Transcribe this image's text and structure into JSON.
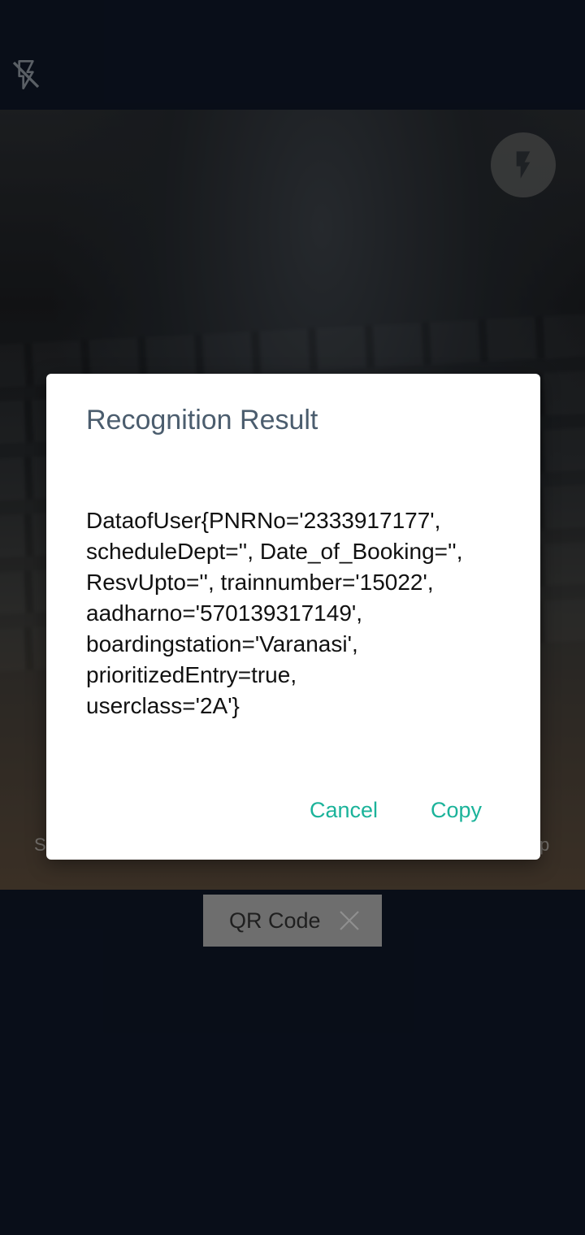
{
  "icons": {
    "flash_off": "flash-off-icon",
    "flash": "flash-icon",
    "close": "close-icon"
  },
  "background": {
    "left_edge_text": "S",
    "right_edge_text": "p"
  },
  "dialog": {
    "title": "Recognition Result",
    "body_lines": [
      "DataofUser{PNRNo='2333917177',",
      "scheduleDept='', Date_of_Booking='',",
      "ResvUpto='', trainnumber='15022',",
      "aadharno='570139317149',",
      "boardingstation='Varanasi',",
      "prioritizedEntry=true,",
      "userclass='2A'}"
    ],
    "cancel_label": "Cancel",
    "copy_label": "Copy"
  },
  "scan_mode": {
    "label": "QR Code"
  },
  "colors": {
    "background": "#0e1626",
    "accent": "#1bb39a",
    "title": "#4b5d6e"
  }
}
